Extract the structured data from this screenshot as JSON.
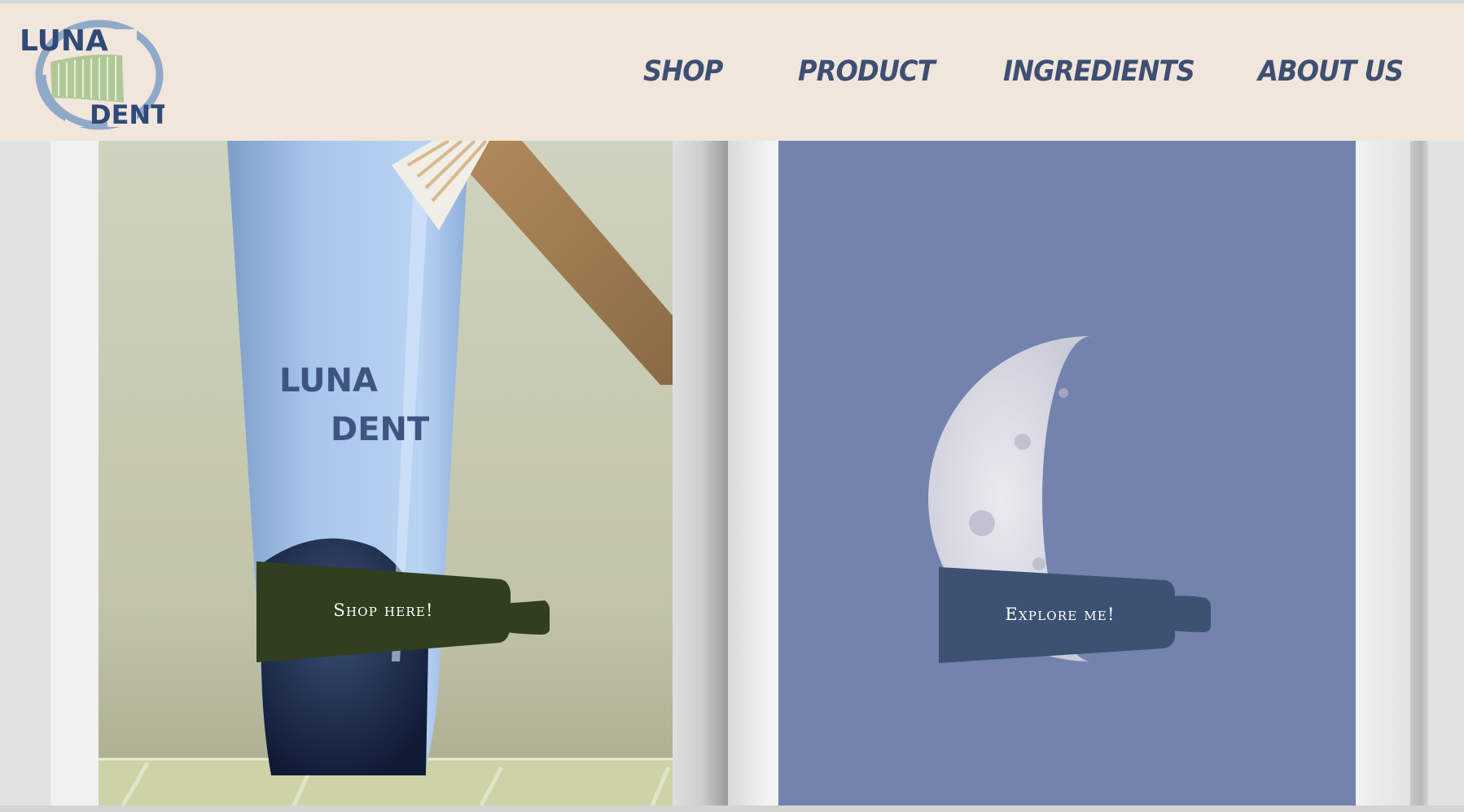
{
  "brand": {
    "logo_line1": "LUNA",
    "logo_line2": "DENT",
    "logo_colors": {
      "text": "#2f4a78",
      "ring": "#8fa9c8",
      "paste": "#a9c48e"
    }
  },
  "nav": {
    "items": [
      {
        "label": "SHOP"
      },
      {
        "label": "PRODUCT"
      },
      {
        "label": "INGREDIENTS"
      },
      {
        "label": "ABOUT US"
      }
    ]
  },
  "hero_left": {
    "tube_brand_line1": "LUNA",
    "tube_brand_line2": "DENT",
    "cta_label": "Shop here!",
    "cta_color": "#323f1f"
  },
  "hero_right": {
    "cta_label": "Explore me!",
    "cta_color": "#3d5272",
    "sky_color": "#7383ad"
  },
  "colors": {
    "header_bg": "#f1e6dc",
    "nav_text": "#3f4f73"
  }
}
